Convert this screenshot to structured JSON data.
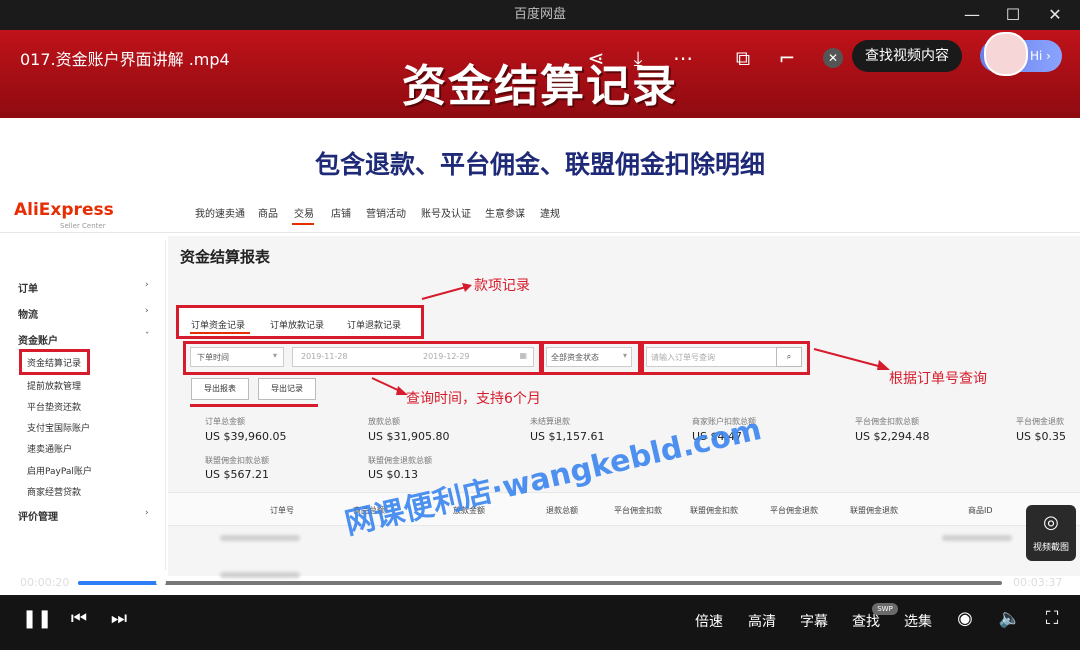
{
  "window": {
    "title": "百度网盘",
    "minimize": "—",
    "maximize": "☐",
    "close": "✕"
  },
  "video": {
    "file_name": "017.资金账户界面讲解 .mp4",
    "slide_title": "资金结算记录",
    "subtitle": "包含退款、平台佣金、联盟佣金扣除明细",
    "find_video_button": "查找视频内容",
    "hi_label": "Hi ›",
    "watermark": "网课便利店·wangkebld.com",
    "screenshot_label": "视频截图"
  },
  "aliexpress": {
    "logo": "AliExpress",
    "logo_sub": "Seller Center",
    "top_nav": [
      "我的速卖通",
      "商品",
      "交易",
      "店铺",
      "营销活动",
      "账号及认证",
      "生意参谋",
      "違规"
    ],
    "sidebar": [
      {
        "label": "订单",
        "type": "header",
        "chevron": "›"
      },
      {
        "label": "物流",
        "type": "header",
        "chevron": "›"
      },
      {
        "label": "资金账户",
        "type": "header",
        "chevron": "ˇ"
      },
      {
        "label": "资金结算记录",
        "type": "item"
      },
      {
        "label": "提前放款管理",
        "type": "item"
      },
      {
        "label": "平台垫资还款",
        "type": "item"
      },
      {
        "label": "支付宝国际账户",
        "type": "item"
      },
      {
        "label": "速卖通账户",
        "type": "item"
      },
      {
        "label": "启用PayPal账户",
        "type": "item"
      },
      {
        "label": "商家经营贷款",
        "type": "item"
      },
      {
        "label": "评价管理",
        "type": "header",
        "chevron": "›"
      }
    ],
    "report_title": "资金结算报表",
    "tabs": [
      "订单资金记录",
      "订单放款记录",
      "订单退款记录"
    ],
    "filters": {
      "time_type": "下单时间",
      "date_start": "2019-11-28",
      "date_end": "2019-12-29",
      "status": "全部资金状态",
      "order_placeholder": "请输入订单号查询"
    },
    "buttons": {
      "export_report": "导出报表",
      "export_records": "导出记录"
    },
    "summary": [
      {
        "label": "订单总金额",
        "value": "US $39,960.05"
      },
      {
        "label": "放款总额",
        "value": "US $31,905.80"
      },
      {
        "label": "未结算退款",
        "value": "US $1,157.61"
      },
      {
        "label": "商家账户扣款总额",
        "value": "US $4.47"
      },
      {
        "label": "平台佣金扣款总额",
        "value": "US $2,294.48"
      },
      {
        "label": "平台佣金退款",
        "value": "US $0.35"
      },
      {
        "label": "联盟佣金扣款总额",
        "value": "US $567.21"
      },
      {
        "label": "联盟佣金退款总额",
        "value": "US $0.13"
      }
    ],
    "table_headers": [
      "订单号",
      "商品总额",
      "放款金额",
      "退款总额",
      "平台佣金扣款",
      "联盟佣金扣款",
      "平台佣金退款",
      "联盟佣金退款",
      "商品ID"
    ]
  },
  "annotations": {
    "tabs": "款项记录",
    "time": "查询时间，支持6个月",
    "order": "根据订单号查询"
  },
  "player": {
    "current_time": "00:00:20",
    "total_time": "00:03:37",
    "progress": 0.09,
    "controls": [
      "倍速",
      "高清",
      "字幕",
      "查找",
      "选集"
    ],
    "swp_badge": "SWP"
  }
}
